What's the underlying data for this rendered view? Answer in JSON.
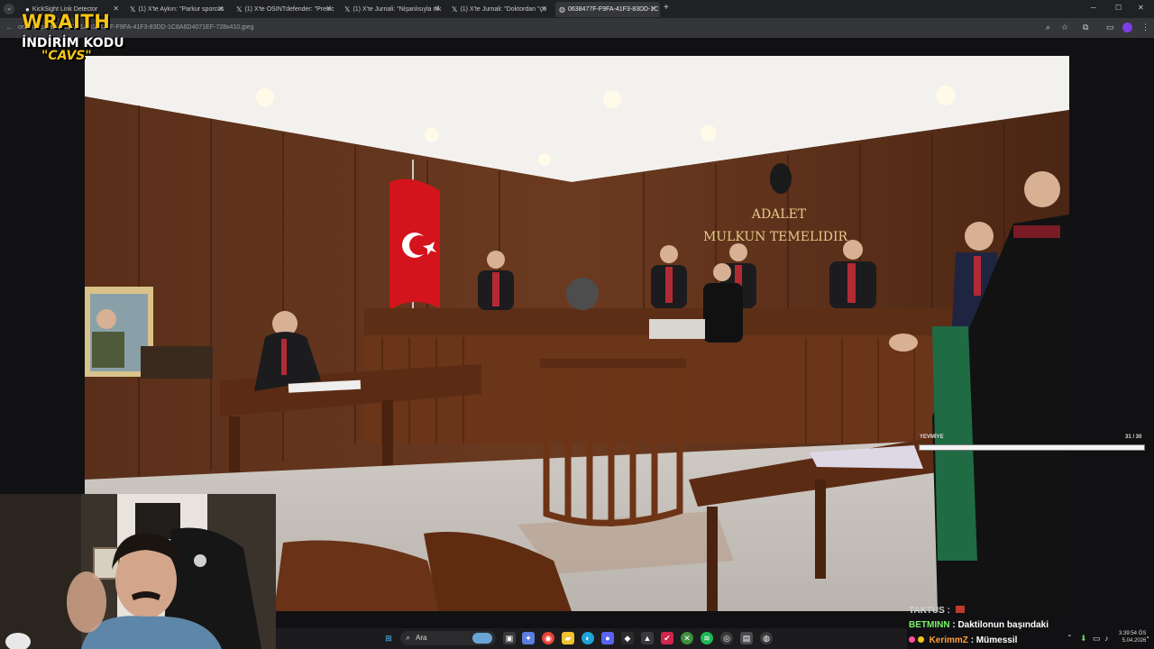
{
  "browser": {
    "tabs": [
      {
        "title": "KickSight Link Detector",
        "active": false
      },
      {
        "title": "(1) X'te Aykırı: \"Parkur sporcus",
        "active": false
      },
      {
        "title": "(1) X'te OSINTdefender: \"Presic",
        "active": false
      },
      {
        "title": "(1) X'te Jurnali: \"Nişanlısıyla nik",
        "active": false
      },
      {
        "title": "(1) X'te Jurnali: \"Doktordan \"ço",
        "active": false
      },
      {
        "title": "0638477F-F9FA-41F3-83DD-1C",
        "active": true
      }
    ],
    "new_tab": "+",
    "url": "ontent/uploads/2022/11/0638477F-F9FA-41F3-83DD-1C8A6D4071EF-728x410.jpeg"
  },
  "overlay": {
    "brand": "WRAITH",
    "promo_line": "İNDİRİM KODU",
    "code": "\"CAVS\""
  },
  "photo": {
    "sign_line1": "ADALET",
    "sign_line2": "MULKUN TEMELIDIR"
  },
  "progress": {
    "label": "YEVMİYE",
    "count": "31 / 30",
    "fraction": 1.0
  },
  "chat": {
    "line0_user": "TAKTUS :",
    "line1_user": "BETMINN",
    "line1_msg": ": Daktilonun başındaki",
    "line2_user": "KerimmZ",
    "line2_msg": ": Mümessil"
  },
  "taskbar": {
    "search": "Ara",
    "time": "3:39:54 ÖS",
    "date": "5.04.2026"
  },
  "colors": {
    "brand_yellow": "#f5c518",
    "chat_green": "#7cf06b",
    "chat_orange": "#ff9e3d"
  }
}
